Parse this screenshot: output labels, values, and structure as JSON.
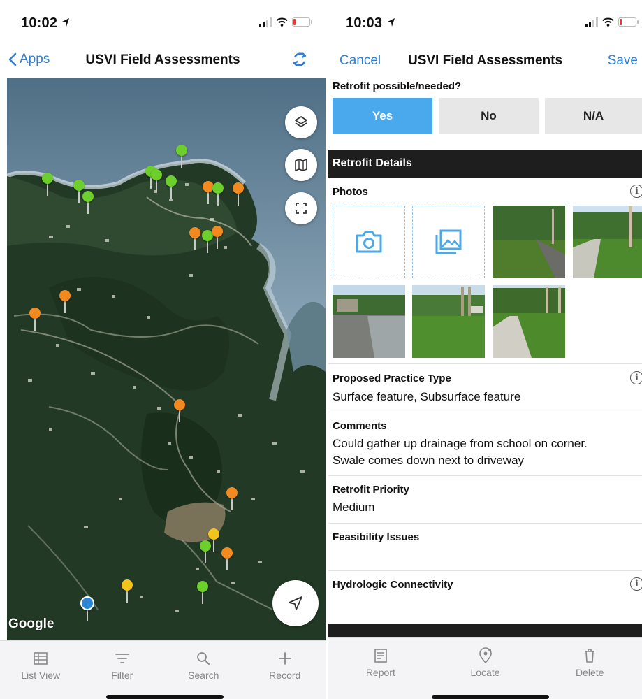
{
  "left": {
    "status": {
      "time": "10:02"
    },
    "nav": {
      "back_label": "Apps",
      "title": "USVI Field Assessments"
    },
    "map": {
      "attribution": "Google",
      "pin_colors": {
        "green": "#6ccf2b",
        "orange": "#f28a1f",
        "yellow": "#f2c41b",
        "blue": "#2b87d6"
      },
      "pins": [
        "green",
        "green",
        "green",
        "green",
        "green",
        "green",
        "green",
        "orange",
        "green",
        "orange",
        "orange",
        "green",
        "orange",
        "orange",
        "orange",
        "orange",
        "orange",
        "yellow",
        "green",
        "orange",
        "yellow",
        "green",
        "blue"
      ],
      "controls": [
        "layers-icon",
        "offline-map-icon",
        "fullscreen-icon",
        "locate-arrow-icon"
      ]
    },
    "tabs": [
      {
        "label": "List View",
        "icon": "list-icon"
      },
      {
        "label": "Filter",
        "icon": "filter-icon"
      },
      {
        "label": "Search",
        "icon": "search-icon"
      },
      {
        "label": "Record",
        "icon": "plus-icon"
      }
    ]
  },
  "right": {
    "status": {
      "time": "10:03"
    },
    "nav": {
      "cancel": "Cancel",
      "title": "USVI Field Assessments",
      "save": "Save"
    },
    "retrofit_question": {
      "label": "Retrofit possible/needed?",
      "options": [
        "Yes",
        "No",
        "N/A"
      ],
      "selected": "Yes"
    },
    "section_retrofit_details": "Retrofit Details",
    "photos": {
      "label": "Photos",
      "count": 7
    },
    "proposed_practice": {
      "label": "Proposed Practice Type",
      "value": "Surface feature, Subsurface feature"
    },
    "comments": {
      "label": "Comments",
      "line1": "Could gather up drainage from school on corner.",
      "line2": "Swale comes down next to driveway"
    },
    "priority": {
      "label": "Retrofit Priority",
      "value": "Medium"
    },
    "feasibility": {
      "label": "Feasibility Issues",
      "value": ""
    },
    "hydrologic": {
      "label": "Hydrologic Connectivity",
      "value": ""
    },
    "info_glyph": "i",
    "tabs": [
      {
        "label": "Report",
        "icon": "report-icon"
      },
      {
        "label": "Locate",
        "icon": "locate-pin-icon"
      },
      {
        "label": "Delete",
        "icon": "trash-icon"
      }
    ],
    "accent": "#4aa8ec"
  }
}
